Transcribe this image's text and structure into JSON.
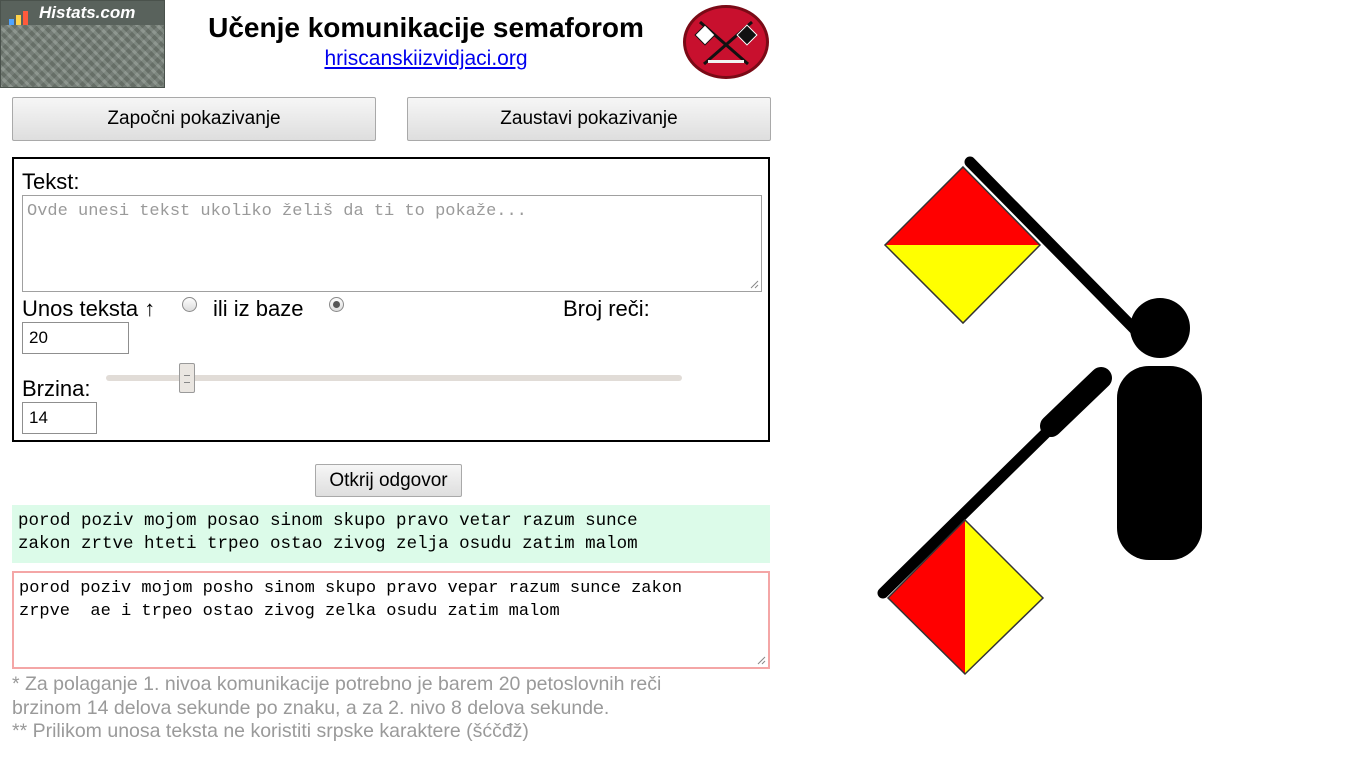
{
  "histats": {
    "name": "Histats.com"
  },
  "header": {
    "title": "Učenje komunikacije semaforom",
    "link_text": "hriscanskiizvidjaci.org"
  },
  "toolbar": {
    "start_label": "Započni pokazivanje",
    "stop_label": "Zaustavi pokazivanje"
  },
  "settings": {
    "text_label": "Tekst:",
    "text_placeholder": "Ovde unesi tekst ukoliko želiš da ti to pokaže...",
    "text_value": "",
    "source_manual_label": "Unos teksta ↑",
    "source_db_label": "ili iz baze",
    "source_selected": "ili iz baze",
    "word_count_label": "Broj reči:",
    "word_count_value": "20",
    "speed_label": "Brzina:",
    "speed_value": "14",
    "speed_slider_fraction": 0.14
  },
  "reveal_label": "Otkrij odgovor",
  "answer_text": "porod poziv mojom posao sinom skupo pravo vetar razum sunce\nzakon zrtve hteti trpeo ostao zivog zelja osudu zatim malom",
  "user_answer": "porod poziv mojom posho sinom skupo pravo vepar razum sunce zakon\nzrpve  ae i trpeo ostao zivog zelka osudu zatim malom",
  "notes": {
    "line1": "* Za polaganje 1. nivoa komunikacije potrebno je barem 20 petoslovnih reči",
    "line2": "brzinom 14 delova sekunde po znaku, a za 2. nivo 8 delova sekunde.",
    "line3": "** Prilikom unosa teksta ne koristiti srpske karaktere (šćčđž)"
  },
  "colors": {
    "flag_red": "#ff0000",
    "flag_yellow": "#ffff00",
    "figure": "#000000",
    "answer_bg": "#dcfbe9",
    "user_answer_border": "#f4a6a6",
    "link": "#0000ee",
    "note_text": "#9a9a9a"
  },
  "icons": {
    "histats_logo": "bar-chart-icon",
    "badge": "crossed-semaphore-flags-badge",
    "figure": "semaphore-signaller-figure"
  }
}
